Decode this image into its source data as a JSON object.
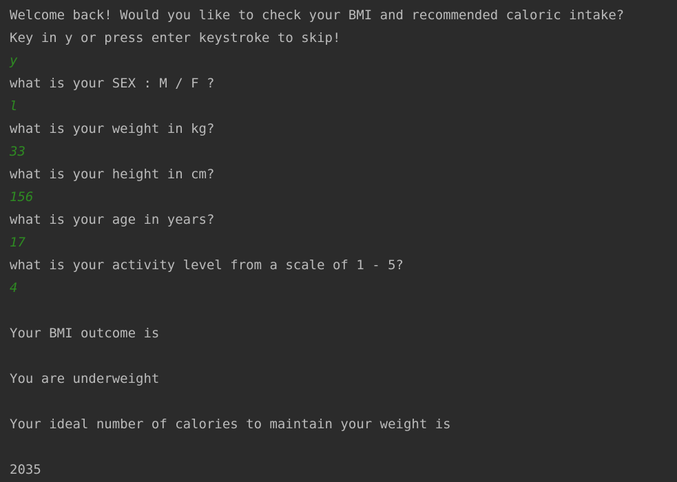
{
  "console": {
    "lines": [
      {
        "kind": "out",
        "text": "Welcome back! Would you like to check your BMI and recommended caloric intake?"
      },
      {
        "kind": "out",
        "text": "Key in y or press enter keystroke to skip!"
      },
      {
        "kind": "in",
        "text": "y"
      },
      {
        "kind": "out",
        "text": "what is your SEX : M / F ?"
      },
      {
        "kind": "in",
        "text": "l"
      },
      {
        "kind": "out",
        "text": "what is your weight in kg?"
      },
      {
        "kind": "in",
        "text": "33"
      },
      {
        "kind": "out",
        "text": "what is your height in cm?"
      },
      {
        "kind": "in",
        "text": "156"
      },
      {
        "kind": "out",
        "text": "what is your age in years?"
      },
      {
        "kind": "in",
        "text": "17"
      },
      {
        "kind": "out",
        "text": "what is your activity level from a scale of 1 - 5?"
      },
      {
        "kind": "in",
        "text": "4"
      },
      {
        "kind": "blank",
        "text": ""
      },
      {
        "kind": "out",
        "text": "Your BMI outcome is"
      },
      {
        "kind": "blank",
        "text": ""
      },
      {
        "kind": "out",
        "text": "You are underweight"
      },
      {
        "kind": "blank",
        "text": ""
      },
      {
        "kind": "out",
        "text": "Your ideal number of calories to maintain your weight is"
      },
      {
        "kind": "blank",
        "text": ""
      },
      {
        "kind": "out",
        "text": "2035"
      }
    ]
  },
  "colors": {
    "background": "#2b2b2b",
    "output_text": "#bbbbbb",
    "user_input": "#2e8b22"
  }
}
